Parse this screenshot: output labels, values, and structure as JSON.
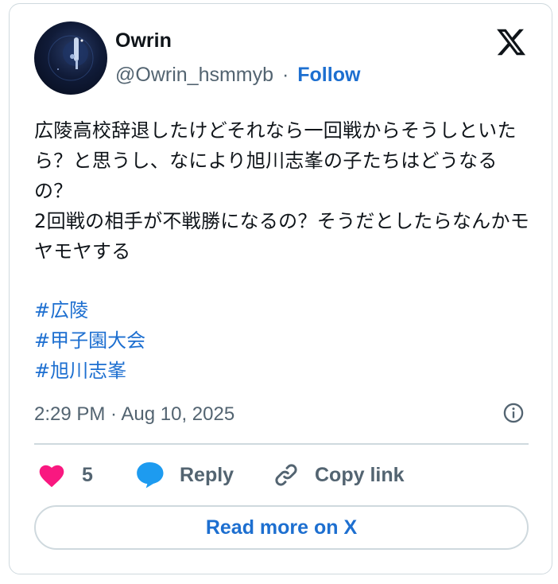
{
  "author": {
    "name": "Owrin",
    "handle": "@Owrin_hsmmyb",
    "separator": "·",
    "follow_label": "Follow"
  },
  "tweet": {
    "text": "広陵高校辞退したけどそれなら一回戦からそうしといたら？と思うし、なにより旭川志峯の子たちはどうなるの？\n2回戦の相手が不戦勝になるの？そうだとしたらなんかモヤモヤする",
    "hashtags": [
      "#広陵",
      "#甲子園大会",
      "#旭川志峯"
    ],
    "timestamp": "2:29 PM · Aug 10, 2025"
  },
  "actions": {
    "like_count": "5",
    "reply_label": "Reply",
    "copy_link_label": "Copy link"
  },
  "read_more_label": "Read more on X",
  "colors": {
    "accent": "#1d6fd0",
    "heart": "#f91880",
    "reply_bubble": "#1d9bf0",
    "muted_text": "#536471",
    "border": "#cfd9de"
  },
  "icons": {
    "brand": "x-logo-icon",
    "info": "info-icon",
    "like": "heart-icon",
    "reply": "speech-bubble-icon",
    "copy_link": "link-icon"
  }
}
